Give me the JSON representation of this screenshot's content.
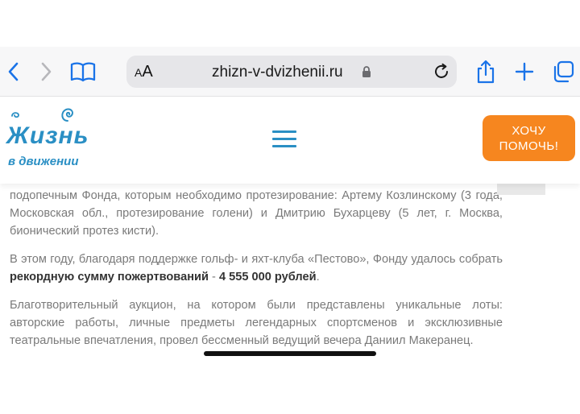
{
  "browser": {
    "text_size_small": "A",
    "text_size_large": "A",
    "url": "zhizn-v-dvizhenii.ru",
    "back_icon": "chevron-left-icon",
    "forward_icon": "chevron-right-icon",
    "bookmarks_icon": "book-icon",
    "lock_icon": "lock-icon",
    "reload_icon": "reload-icon",
    "share_icon": "share-icon",
    "new_tab_icon": "plus-icon",
    "tabs_icon": "tabs-icon",
    "accent": "#1a73e8"
  },
  "site": {
    "logo_line1": "Жизнь",
    "logo_line2": "в движении",
    "menu_icon": "hamburger-menu-icon",
    "help_button": "ХОЧУ ПОМОЧЬ!",
    "brand_blue": "#2a8fc4",
    "brand_orange": "#f6861f"
  },
  "article": {
    "p1": "подопечным Фонда, которым необходимо протезирование: Артему Козлинскому (3 года, Московская обл., протезирование голени) и Дмитрию Бухарцеву (5 лет, г. Москва, бионический протез кисти).",
    "p2_text": "В этом году, благодаря поддержке гольф- и яхт-клуба «Пестово», Фонду удалось собрать ",
    "p2_bold1": "рекордную сумму пожертвований",
    "p2_sep": " - ",
    "p2_bold2": "4 555 000 рублей",
    "p2_end": ".",
    "p3": "Благотворительный аукцион, на котором были представлены уникальные лоты: авторские работы, личные предметы легендарных спортсменов и эксклюзивные театральные впечатления, провел бессменный ведущий вечера Даниил Макеранец."
  }
}
